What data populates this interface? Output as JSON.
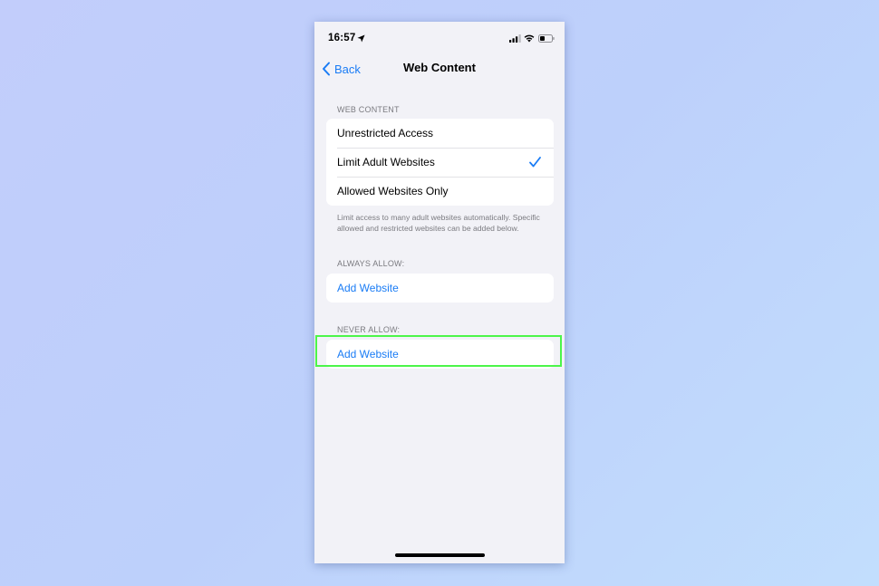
{
  "status_bar": {
    "time": "16:57"
  },
  "nav": {
    "back_label": "Back",
    "title": "Web Content"
  },
  "web_content": {
    "header": "WEB CONTENT",
    "options": [
      {
        "label": "Unrestricted Access",
        "selected": false
      },
      {
        "label": "Limit Adult Websites",
        "selected": true
      },
      {
        "label": "Allowed Websites Only",
        "selected": false
      }
    ],
    "footer": "Limit access to many adult websites automatically. Specific allowed and restricted websites can be added below."
  },
  "always_allow": {
    "header": "ALWAYS ALLOW:",
    "add_label": "Add Website"
  },
  "never_allow": {
    "header": "NEVER ALLOW:",
    "add_label": "Add Website"
  },
  "colors": {
    "accent": "#1a7cf5",
    "highlight": "#4cf54a",
    "background": "#f2f2f7"
  },
  "icons": [
    "location-arrow-icon",
    "cellular-signal-icon",
    "wifi-icon",
    "battery-icon",
    "back-chevron-icon",
    "checkmark-icon"
  ]
}
